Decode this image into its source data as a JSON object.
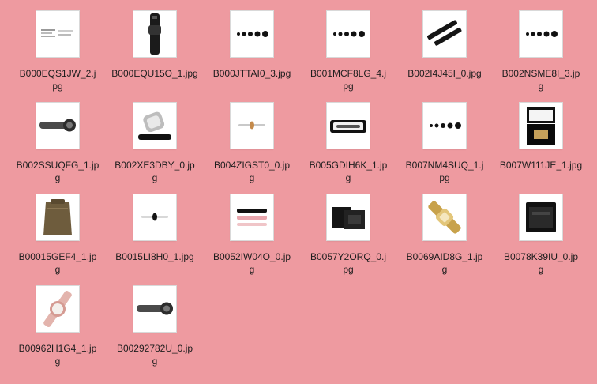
{
  "window": {
    "background_color": "#ee9aa0"
  },
  "files": [
    {
      "line1": "B000EQS1JW_2.j",
      "line2": "pg",
      "icon": "document-scan-thumbnail-icon"
    },
    {
      "line1": "B000EQU15O_1.jpg",
      "line2": "",
      "icon": "black-watch-strap-thumbnail-icon"
    },
    {
      "line1": "B000JTTAI0_3.jpg",
      "line2": "",
      "icon": "dot-row-thumbnail-icon"
    },
    {
      "line1": "B001MCF8LG_4.j",
      "line2": "pg",
      "icon": "dot-row-thumbnail-icon"
    },
    {
      "line1": "B002I4J45I_0.jpg",
      "line2": "",
      "icon": "black-straps-thumbnail-icon"
    },
    {
      "line1": "B002NSME8I_3.jp",
      "line2": "g",
      "icon": "dot-row-thumbnail-icon"
    },
    {
      "line1": "B002SSUQFG_1.jp",
      "line2": "g",
      "icon": "watch-side-thumbnail-icon"
    },
    {
      "line1": "B002XE3DBY_0.jp",
      "line2": "g",
      "icon": "silver-watch-thumbnail-icon"
    },
    {
      "line1": "B004ZIGST0_0.jp",
      "line2": "g",
      "icon": "small-watch-thumbnail-icon"
    },
    {
      "line1": "B005GDIH6K_1.jp",
      "line2": "g",
      "icon": "open-watch-box-thumbnail-icon"
    },
    {
      "line1": "B007NM4SUQ_1.j",
      "line2": "pg",
      "icon": "dot-row-thumbnail-icon"
    },
    {
      "line1": "B007W111JE_1.jpg",
      "line2": "",
      "icon": "watch-box-thumbnail-icon"
    },
    {
      "line1": "B00015GEF4_1.jp",
      "line2": "g",
      "icon": "pouch-bag-thumbnail-icon"
    },
    {
      "line1": "B0015LI8H0_1.jpg",
      "line2": "",
      "icon": "small-watch-thumbnail-icon"
    },
    {
      "line1": "B0052IW04O_0.jp",
      "line2": "g",
      "icon": "strap-set-thumbnail-icon"
    },
    {
      "line1": "B0057Y2ORQ_0.j",
      "line2": "pg",
      "icon": "gift-box-thumbnail-icon"
    },
    {
      "line1": "B0069AID8G_1.jp",
      "line2": "g",
      "icon": "gold-watch-thumbnail-icon"
    },
    {
      "line1": "B0078K39IU_0.jp",
      "line2": "g",
      "icon": "black-box-thumbnail-icon"
    },
    {
      "line1": "B00962H1G4_1.jp",
      "line2": "g",
      "icon": "rose-gold-watch-thumbnail-icon"
    },
    {
      "line1": "B00292782U_0.jp",
      "line2": "g",
      "icon": "watch-side-thumbnail-icon"
    }
  ]
}
